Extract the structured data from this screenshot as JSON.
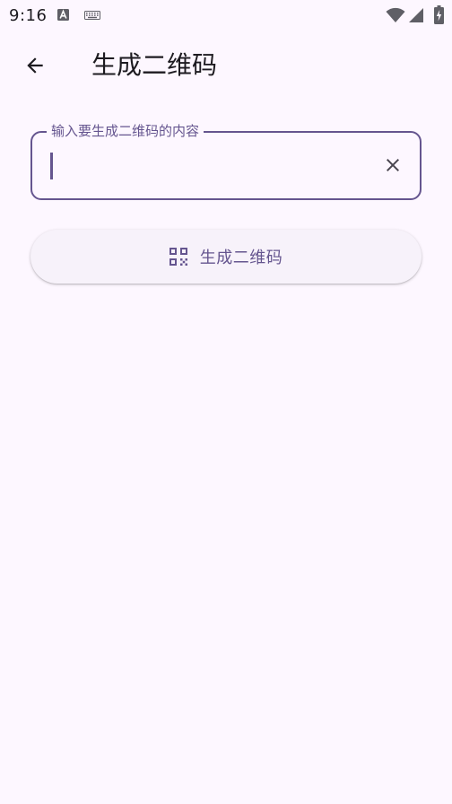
{
  "status_bar": {
    "time": "9:16",
    "icons": [
      "a-app-icon",
      "keyboard-icon",
      "wifi-icon",
      "signal-icon",
      "battery-charging-icon"
    ]
  },
  "app_bar": {
    "back_icon": "arrow-back-icon",
    "title": "生成二维码"
  },
  "input": {
    "label": "输入要生成二维码的内容",
    "value": "",
    "clear_icon": "close-icon"
  },
  "generate_button": {
    "icon": "qr-code-icon",
    "label": "生成二维码"
  },
  "colors": {
    "background": "#fdf7ff",
    "primary": "#65558f",
    "on_surface": "#1d1b20",
    "button_surface": "#f7f2fa"
  }
}
